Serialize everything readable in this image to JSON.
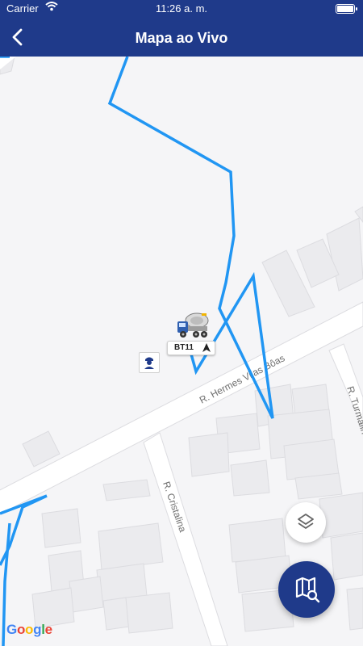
{
  "status_bar": {
    "carrier": "Carrier",
    "time": "11:26 a. m."
  },
  "header": {
    "title": "Mapa ao Vivo",
    "background": "#1f3a8a"
  },
  "map": {
    "streets": [
      "R. Hermes Vilas Bôas",
      "R. Cristalina",
      "R. Turmalin"
    ],
    "route_color": "#2196f3",
    "vehicle": {
      "label": "BT11",
      "icon": "concrete-mixer-truck-icon"
    },
    "attribution": [
      "G",
      "o",
      "o",
      "g",
      "l",
      "e"
    ]
  },
  "controls": {
    "layers_icon": "layers-icon",
    "map_search_icon": "map-search-icon"
  }
}
